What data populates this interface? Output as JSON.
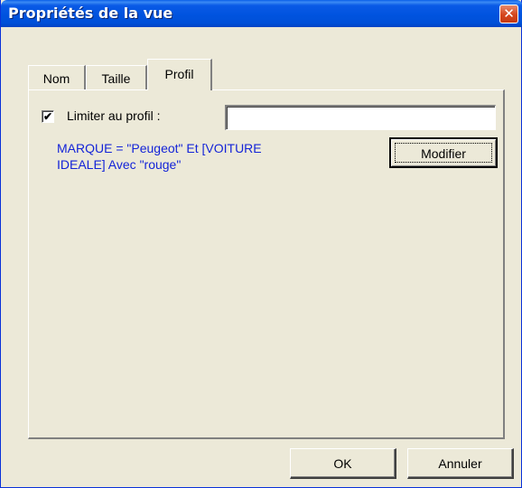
{
  "window": {
    "title": "Propriétés de la vue",
    "close_glyph": "✕"
  },
  "tabs": [
    {
      "label": "Nom",
      "selected": false
    },
    {
      "label": "Taille",
      "selected": false
    },
    {
      "label": "Profil",
      "selected": true
    }
  ],
  "profil": {
    "checkbox_label": "Limiter au profil :",
    "checkbox_checked": true,
    "checkmark_glyph": "✔",
    "input_value": "",
    "expression_line1": "MARQUE = \"Peugeot\" Et [VOITURE",
    "expression_line2": "IDEALE] Avec \"rouge\"",
    "expression_color": "#1424d8",
    "modify_label": "Modifier"
  },
  "buttons": {
    "ok_label": "OK",
    "cancel_label": "Annuler"
  },
  "colors": {
    "titlebar": "#0053df",
    "close": "#d5461c",
    "face": "#ece9d8"
  }
}
